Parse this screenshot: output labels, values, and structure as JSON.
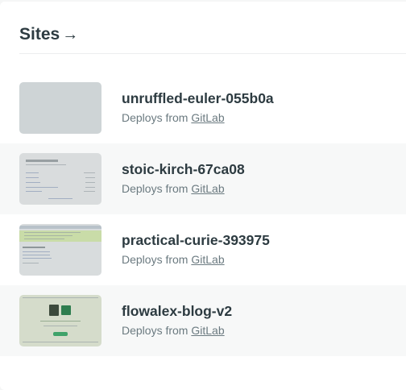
{
  "header": {
    "title": "Sites",
    "arrow": "→"
  },
  "sites": [
    {
      "name": "unruffled-euler-055b0a",
      "deploy_prefix": "Deploys from",
      "provider": "GitLab"
    },
    {
      "name": "stoic-kirch-67ca08",
      "deploy_prefix": "Deploys from",
      "provider": "GitLab"
    },
    {
      "name": "practical-curie-393975",
      "deploy_prefix": "Deploys from",
      "provider": "GitLab"
    },
    {
      "name": "flowalex-blog-v2",
      "deploy_prefix": "Deploys from",
      "provider": "GitLab"
    }
  ]
}
